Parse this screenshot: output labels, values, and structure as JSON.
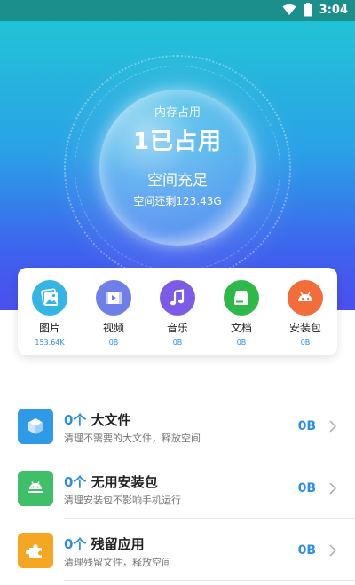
{
  "status_bar": {
    "time": "3:04"
  },
  "hero": {
    "memory_label": "内存占用",
    "used_value": "1已占用",
    "space_status": "空间充足",
    "space_remaining": "空间还剩123.43G"
  },
  "categories": [
    {
      "name": "图片",
      "size": "153.64K",
      "icon": "image-icon",
      "color": "#33b5e5"
    },
    {
      "name": "视频",
      "size": "0B",
      "icon": "video-icon",
      "color": "#6f7fe8"
    },
    {
      "name": "音乐",
      "size": "0B",
      "icon": "music-icon",
      "color": "#7c5ce6"
    },
    {
      "name": "文档",
      "size": "0B",
      "icon": "document-icon",
      "color": "#2fb84a"
    },
    {
      "name": "安装包",
      "size": "0B",
      "icon": "android-icon",
      "color": "#f26d3a"
    }
  ],
  "cleanup_items": [
    {
      "count": "0个",
      "title": "大文件",
      "description": "清理不需要的大文件，释放空间",
      "size": "0B",
      "icon": "cube-icon",
      "color": "#2f9ae6"
    },
    {
      "count": "0个",
      "title": "无用安装包",
      "description": "清理安装包不影响手机运行",
      "size": "0B",
      "icon": "android-icon",
      "color": "#3fbf6a"
    },
    {
      "count": "0个",
      "title": "残留应用",
      "description": "清理残留文件，释放空间",
      "size": "0B",
      "icon": "puzzle-icon",
      "color": "#f5a623"
    }
  ]
}
